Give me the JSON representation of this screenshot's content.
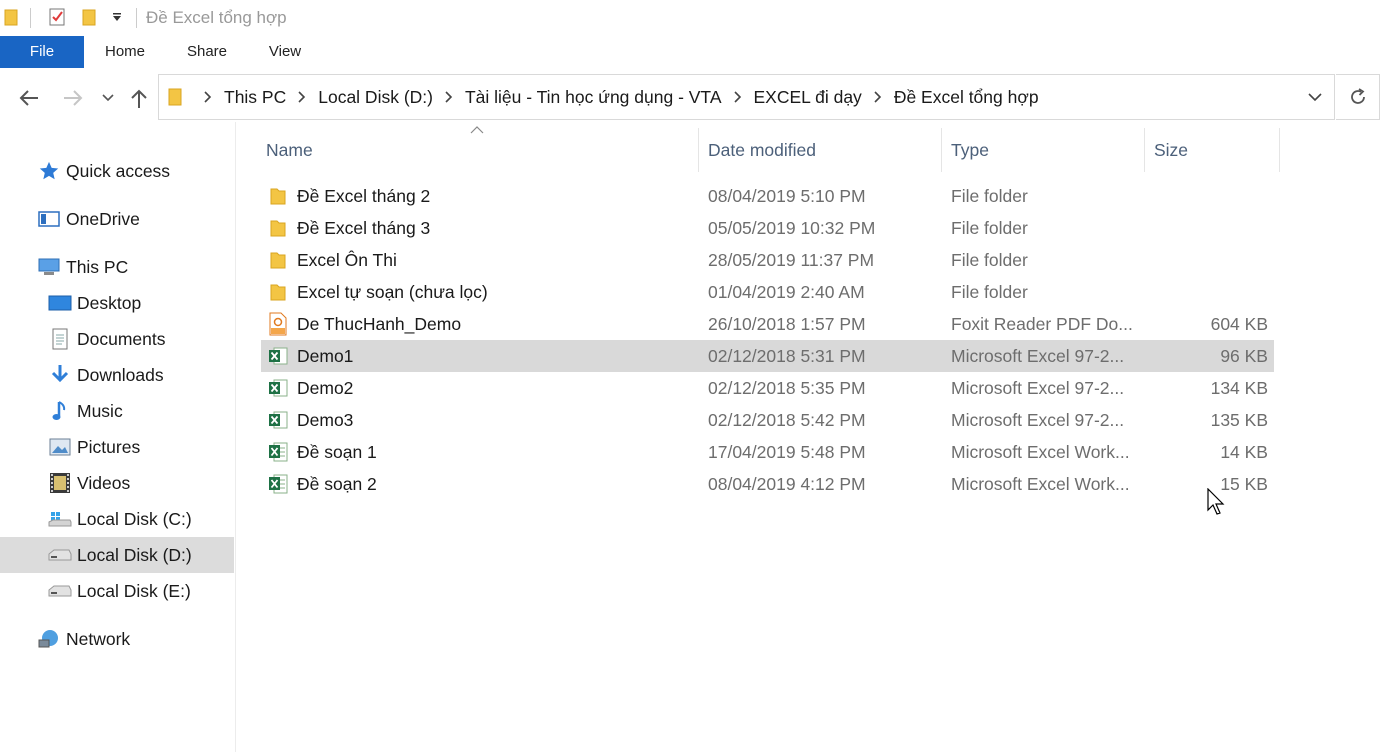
{
  "window": {
    "title": "Đề Excel tổng hợp"
  },
  "ribbon": {
    "tabs": [
      "File",
      "Home",
      "Share",
      "View"
    ]
  },
  "address": {
    "crumbs": [
      "This PC",
      "Local Disk (D:)",
      "Tài liệu - Tin học ứng dụng - VTA",
      "EXCEL đi dạy",
      "Đề Excel tổng hợp"
    ]
  },
  "nav": {
    "items": [
      {
        "label": "Quick access",
        "icon": "star-icon"
      },
      {
        "label": "OneDrive",
        "icon": "cloud-icon"
      },
      {
        "label": "This PC",
        "icon": "computer-icon"
      },
      {
        "label": "Desktop",
        "icon": "desktop-icon"
      },
      {
        "label": "Documents",
        "icon": "documents-icon"
      },
      {
        "label": "Downloads",
        "icon": "download-icon"
      },
      {
        "label": "Music",
        "icon": "music-icon"
      },
      {
        "label": "Pictures",
        "icon": "pictures-icon"
      },
      {
        "label": "Videos",
        "icon": "videos-icon"
      },
      {
        "label": "Local Disk (C:)",
        "icon": "drive-icon"
      },
      {
        "label": "Local Disk (D:)",
        "icon": "drive-icon"
      },
      {
        "label": "Local Disk (E:)",
        "icon": "drive-icon"
      },
      {
        "label": "Network",
        "icon": "network-icon"
      }
    ],
    "selected": "Local Disk (D:)"
  },
  "columns": {
    "name": "Name",
    "date": "Date modified",
    "type": "Type",
    "size": "Size"
  },
  "files": [
    {
      "name": "Đề Excel tháng 2",
      "date": "08/04/2019 5:10 PM",
      "type": "File folder",
      "size": "",
      "icon": "folder-icon"
    },
    {
      "name": "Đề Excel tháng 3",
      "date": "05/05/2019 10:32 PM",
      "type": "File folder",
      "size": "",
      "icon": "folder-icon"
    },
    {
      "name": "Excel Ôn Thi",
      "date": "28/05/2019 11:37 PM",
      "type": "File folder",
      "size": "",
      "icon": "folder-icon"
    },
    {
      "name": "Excel tự soạn (chưa lọc)",
      "date": "01/04/2019 2:40 AM",
      "type": "File folder",
      "size": "",
      "icon": "folder-icon"
    },
    {
      "name": "De ThucHanh_Demo",
      "date": "26/10/2018 1:57 PM",
      "type": "Foxit Reader PDF Do...",
      "size": "604 KB",
      "icon": "pdf-icon"
    },
    {
      "name": "Demo1",
      "date": "02/12/2018 5:31 PM",
      "type": "Microsoft Excel 97-2...",
      "size": "96 KB",
      "icon": "excel-icon"
    },
    {
      "name": "Demo2",
      "date": "02/12/2018 5:35 PM",
      "type": "Microsoft Excel 97-2...",
      "size": "134 KB",
      "icon": "excel-icon"
    },
    {
      "name": "Demo3",
      "date": "02/12/2018 5:42 PM",
      "type": "Microsoft Excel 97-2...",
      "size": "135 KB",
      "icon": "excel-icon"
    },
    {
      "name": "Đề soạn 1",
      "date": "17/04/2019 5:48 PM",
      "type": "Microsoft Excel Work...",
      "size": "14 KB",
      "icon": "excel-icon"
    },
    {
      "name": "Đề soạn 2",
      "date": "08/04/2019 4:12 PM",
      "type": "Microsoft Excel Work...",
      "size": "15 KB",
      "icon": "excel-icon"
    }
  ],
  "selected_file": "Demo1",
  "colors": {
    "accent": "#1965c4",
    "selection": "#d9d9d9",
    "folder": "#f3c544",
    "excel": "#1e7145"
  }
}
